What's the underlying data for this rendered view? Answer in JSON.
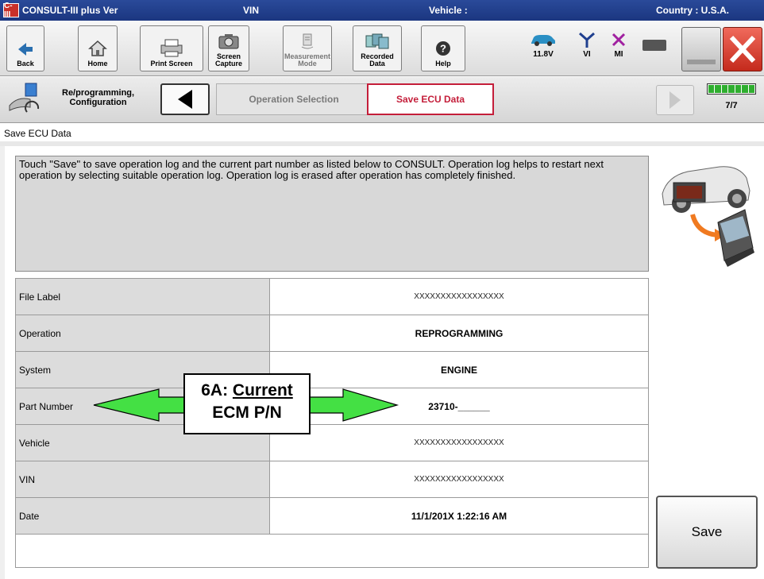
{
  "titlebar": {
    "logo": "C-III",
    "app": "CONSULT-III plus Ver",
    "vin": "VIN",
    "vehicle": "Vehicle :",
    "country": "Country : U.S.A."
  },
  "toolbar": {
    "back": "Back",
    "home": "Home",
    "print": "Print Screen",
    "screen_capture_1": "Screen",
    "screen_capture_2": "Capture",
    "measurement_1": "Measurement",
    "measurement_2": "Mode",
    "recorded_1": "Recorded",
    "recorded_2": "Data",
    "help": "Help",
    "voltage": "11.8V",
    "vi": "VI",
    "mi": "MI"
  },
  "nav": {
    "title_1": "Re/programming,",
    "title_2": "Configuration",
    "crumb_operation": "Operation Selection",
    "crumb_save": "Save ECU Data",
    "page": "7/7"
  },
  "section_label": "Save ECU Data",
  "message": "Touch \"Save\" to save operation log and the current part number as listed below to CONSULT. Operation log helps to restart next operation by selecting suitable operation log. Operation log is erased after operation has completely finished.",
  "table": {
    "rows": [
      {
        "label": "File Label",
        "value": "XXXXXXXXXXXXXXXXX"
      },
      {
        "label": "Operation",
        "value": "REPROGRAMMING"
      },
      {
        "label": "System",
        "value": "ENGINE"
      },
      {
        "label": "Part Number",
        "value": "23710-______"
      },
      {
        "label": "Vehicle",
        "value": "XXXXXXXXXXXXXXXXX"
      },
      {
        "label": "VIN",
        "value": "XXXXXXXXXXXXXXXXX"
      },
      {
        "label": "Date",
        "value": "11/1/201X 1:22:16 AM"
      }
    ]
  },
  "save_button": "Save",
  "callout": {
    "line1_prefix": "6A: ",
    "line1_underlined": "Current",
    "line2": "ECM P/N"
  },
  "colors": {
    "title_bar": "#1b3680",
    "active_crumb": "#c41e3a",
    "arrow": "#33e033",
    "progress": "#2fae2f"
  }
}
